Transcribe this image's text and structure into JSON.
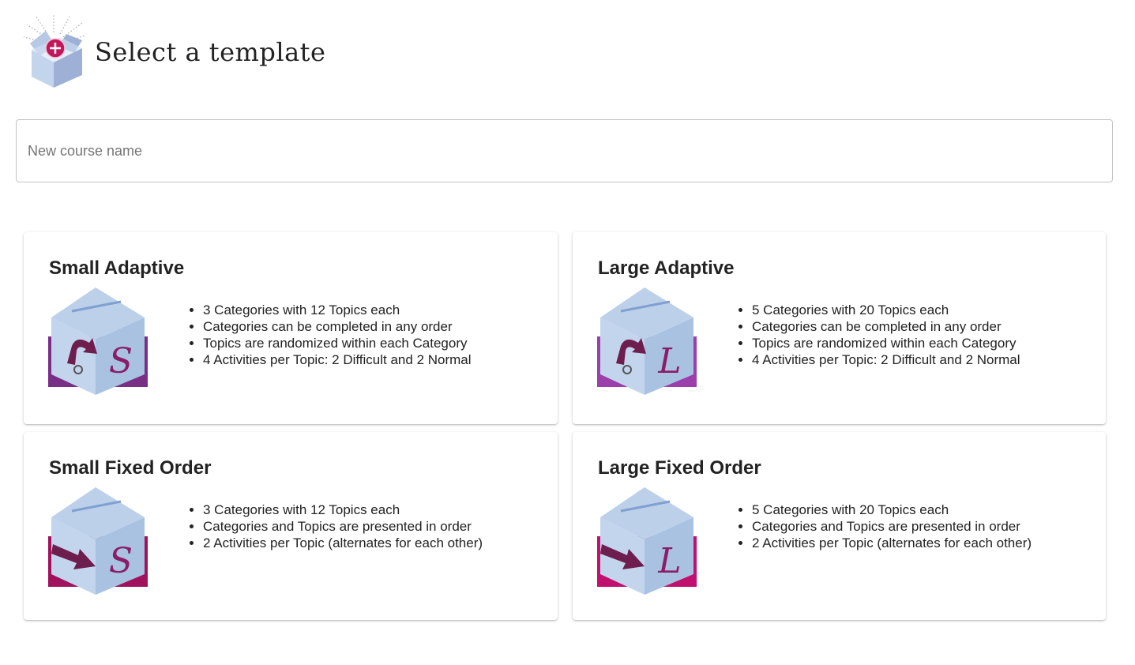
{
  "header": {
    "title": "Select a template",
    "icon": "new-course-box-icon"
  },
  "course_name": {
    "value": "",
    "placeholder": "New course name"
  },
  "templates": [
    {
      "title": "Small Adaptive",
      "icon": "small-adaptive-box-icon",
      "letter": "S",
      "band_color": "#7a2f86",
      "features": [
        "3 Categories with 12 Topics each",
        "Categories can be completed in any order",
        "Topics are randomized within each Category",
        "4 Activities per Topic: 2 Difficult and 2 Normal"
      ]
    },
    {
      "title": "Large Adaptive",
      "icon": "large-adaptive-box-icon",
      "letter": "L",
      "band_color": "#9b3fab",
      "features": [
        "5 Categories with 20 Topics each",
        "Categories can be completed in any order",
        "Topics are randomized within each Category",
        "4 Activities per Topic: 2 Difficult and 2 Normal"
      ]
    },
    {
      "title": "Small Fixed Order",
      "icon": "small-fixed-order-box-icon",
      "letter": "S",
      "band_color": "#a0125e",
      "features": [
        "3 Categories with 12 Topics each",
        "Categories and Topics are presented in order",
        "2 Activities per Topic (alternates for each other)"
      ]
    },
    {
      "title": "Large Fixed Order",
      "icon": "large-fixed-order-box-icon",
      "letter": "L",
      "band_color": "#c2106e",
      "features": [
        "5 Categories with 20 Topics each",
        "Categories and Topics are presented in order",
        "2 Activities per Topic (alternates for each other)"
      ]
    }
  ],
  "colors": {
    "box_light": "#c3d5ec",
    "box_mid": "#a9c2e2",
    "box_dark": "#9eb0d6",
    "letter": "#8a1c6a",
    "arrow": "#6e1e4e",
    "plus_badge": "#c2185b"
  }
}
